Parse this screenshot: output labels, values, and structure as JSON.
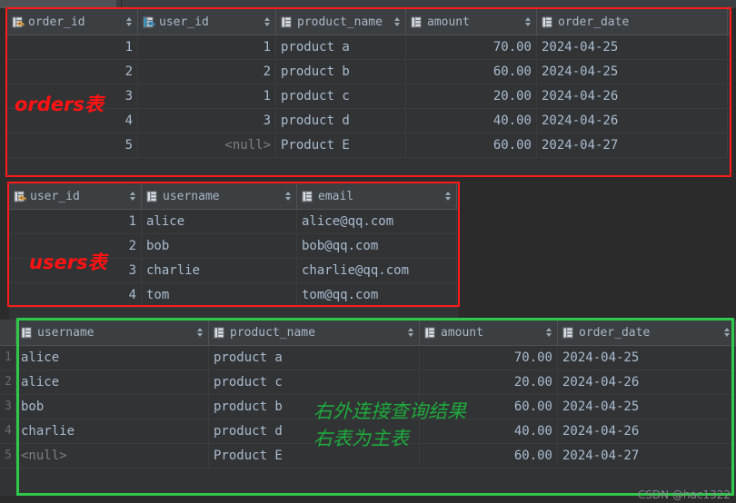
{
  "theme": {
    "bg": "#2b2b2b",
    "grid_bg": "#313335",
    "header_bg": "#3c3f41",
    "text": "#a9bcd0",
    "header_text": "#a9b7c6",
    "null_text": "#808080",
    "annotation_red": "#ff1212",
    "annotation_green": "#1faa3c",
    "pk_key_color": "#e8a33d",
    "fk_key_color": "#3592c4"
  },
  "orders_table": {
    "annotation": "orders表",
    "columns": [
      {
        "label": "order_id",
        "icon": "table-primary-key-icon",
        "sortable": true,
        "align": "right"
      },
      {
        "label": "user_id",
        "icon": "table-foreign-key-icon",
        "sortable": true,
        "align": "right"
      },
      {
        "label": "product_name",
        "icon": "table-column-icon",
        "sortable": true,
        "align": "left"
      },
      {
        "label": "amount",
        "icon": "table-column-icon",
        "sortable": true,
        "align": "right"
      },
      {
        "label": "order_date",
        "icon": "table-column-icon",
        "sortable": false,
        "align": "left"
      }
    ],
    "rows": [
      [
        "1",
        "1",
        "product a",
        "70.00",
        "2024-04-25"
      ],
      [
        "2",
        "2",
        "product b",
        "60.00",
        "2024-04-25"
      ],
      [
        "3",
        "1",
        "product c",
        "20.00",
        "2024-04-26"
      ],
      [
        "4",
        "3",
        "product d",
        "40.00",
        "2024-04-26"
      ],
      [
        "5",
        "<null>",
        "Product E",
        "60.00",
        "2024-04-27"
      ]
    ]
  },
  "users_table": {
    "annotation": "users表",
    "columns": [
      {
        "label": "user_id",
        "icon": "table-primary-key-icon",
        "sortable": true,
        "align": "right"
      },
      {
        "label": "username",
        "icon": "table-column-icon",
        "sortable": true,
        "align": "left"
      },
      {
        "label": "email",
        "icon": "table-column-icon",
        "sortable": true,
        "align": "left"
      }
    ],
    "rows": [
      [
        "1",
        "alice",
        "alice@qq.com"
      ],
      [
        "2",
        "bob",
        "bob@qq.com"
      ],
      [
        "3",
        "charlie",
        "charlie@qq.com"
      ],
      [
        "4",
        "tom",
        "tom@qq.com"
      ]
    ]
  },
  "result_table": {
    "annotation_line1": "右外连接查询结果",
    "annotation_line2": "右表为主表",
    "columns": [
      {
        "label": "username",
        "icon": "table-column-icon",
        "sortable": true,
        "align": "left"
      },
      {
        "label": "product_name",
        "icon": "table-column-icon",
        "sortable": true,
        "align": "left"
      },
      {
        "label": "amount",
        "icon": "table-column-icon",
        "sortable": true,
        "align": "right"
      },
      {
        "label": "order_date",
        "icon": "table-column-icon",
        "sortable": true,
        "align": "left"
      }
    ],
    "row_numbers": [
      "1",
      "2",
      "3",
      "4",
      "5"
    ],
    "rows": [
      [
        "alice",
        "product a",
        "70.00",
        "2024-04-25"
      ],
      [
        "alice",
        "product c",
        "20.00",
        "2024-04-26"
      ],
      [
        "bob",
        "product b",
        "60.00",
        "2024-04-25"
      ],
      [
        "charlie",
        "product d",
        "40.00",
        "2024-04-26"
      ],
      [
        "<null>",
        "Product E",
        "60.00",
        "2024-04-27"
      ]
    ]
  },
  "watermark": "CSDN @hac1322"
}
